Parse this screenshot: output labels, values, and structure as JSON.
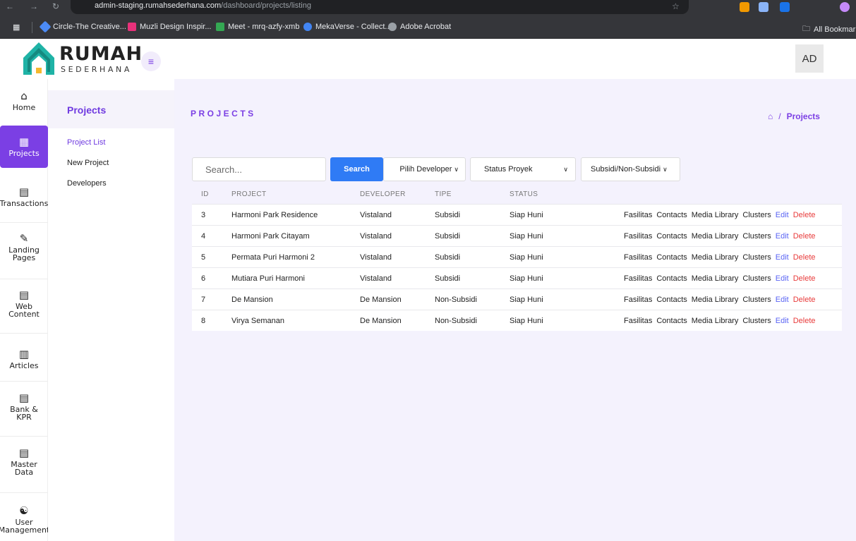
{
  "browser": {
    "url_domain": "admin-staging.rumahsederhana.com",
    "url_path": "/dashboard/projects/listing",
    "bookmarks": [
      "Circle-The Creative...",
      "Muzli Design Inspir...",
      "Meet - mrq-azfy-xmb",
      "MekaVerse - Collect...",
      "Adobe Acrobat"
    ],
    "all_bookmarks": "All Bookmarks"
  },
  "header": {
    "logo_title": "RUMAH",
    "logo_subtitle": "SEDERHANA",
    "avatar": "AD"
  },
  "rail": [
    {
      "label": "Home",
      "icon": "home-icon"
    },
    {
      "label": "Projects",
      "icon": "map-icon",
      "active": true
    },
    {
      "label": "Transactions",
      "icon": "clipboard-icon"
    },
    {
      "label": "Landing Pages",
      "icon": "edit-icon"
    },
    {
      "label": "Web Content",
      "icon": "clipboard-icon"
    },
    {
      "label": "Articles",
      "icon": "document-icon"
    },
    {
      "label": "Bank & KPR",
      "icon": "clipboard-icon"
    },
    {
      "label": "Master Data",
      "icon": "clipboard-icon"
    },
    {
      "label": "User Management",
      "icon": "users-icon"
    }
  ],
  "subnav": {
    "title": "Projects",
    "items": [
      "Project List",
      "New Project",
      "Developers"
    ]
  },
  "main": {
    "page_title": "PROJECTS",
    "breadcrumb": "Projects",
    "search_placeholder": "Search...",
    "search_button": "Search",
    "filters": {
      "developer": "Pilih Developer",
      "status": "Status Proyek",
      "subsidi": "Subsidi/Non-Subsidi"
    },
    "table": {
      "headers": [
        "ID",
        "PROJECT",
        "DEVELOPER",
        "TIPE",
        "STATUS"
      ],
      "rows": [
        {
          "id": "3",
          "project": "Harmoni Park Residence",
          "developer": "Vistaland",
          "tipe": "Subsidi",
          "status": "Siap Huni"
        },
        {
          "id": "4",
          "project": "Harmoni Park Citayam",
          "developer": "Vistaland",
          "tipe": "Subsidi",
          "status": "Siap Huni"
        },
        {
          "id": "5",
          "project": "Permata Puri Harmoni 2",
          "developer": "Vistaland",
          "tipe": "Subsidi",
          "status": "Siap Huni"
        },
        {
          "id": "6",
          "project": "Mutiara Puri Harmoni",
          "developer": "Vistaland",
          "tipe": "Subsidi",
          "status": "Siap Huni"
        },
        {
          "id": "7",
          "project": "De Mansion",
          "developer": "De Mansion",
          "tipe": "Non-Subsidi",
          "status": "Siap Huni"
        },
        {
          "id": "8",
          "project": "Virya Semanan",
          "developer": "De Mansion",
          "tipe": "Non-Subsidi",
          "status": "Siap Huni"
        }
      ],
      "actions": [
        "Fasilitas",
        "Contacts",
        "Media Library",
        "Clusters",
        "Edit",
        "Delete"
      ]
    }
  },
  "colors": {
    "accent": "#7b3fe4",
    "search_button": "#2f7bf5",
    "edit": "#5a64f4",
    "delete": "#e83b3b",
    "content_bg": "#f4f2fd"
  }
}
